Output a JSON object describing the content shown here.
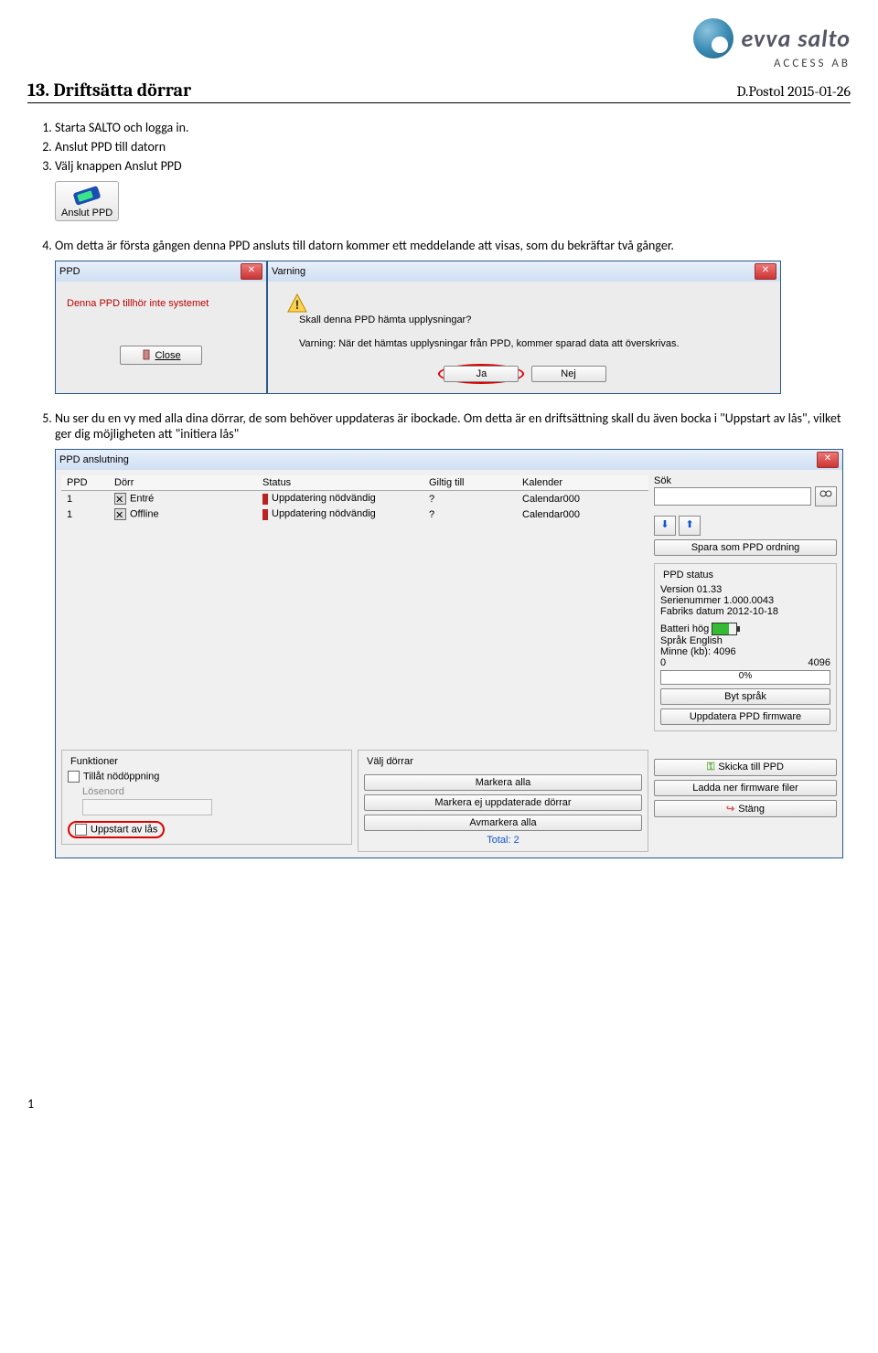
{
  "logo": {
    "line1": "evva salto",
    "line2": "ACCESS AB"
  },
  "title": "13. Driftsätta dörrar",
  "date": "D.Postol 2015-01-26",
  "steps123": [
    "Starta SALTO och logga in.",
    "Anslut PPD till datorn",
    "Välj knappen Anslut PPD"
  ],
  "anslut_btn_label": "Anslut PPD",
  "step4": "Om detta är första gången denna PPD ansluts till datorn kommer ett meddelande att visas, som du bekräftar två gånger.",
  "ppd_dialog": {
    "title": "PPD",
    "msg": "Denna PPD tillhör inte systemet",
    "close": "Close"
  },
  "warn_dialog": {
    "title": "Varning",
    "line1": "Skall denna PPD hämta upplysningar?",
    "line2": "Varning: När det hämtas upplysningar från PPD, kommer sparad data att överskrivas.",
    "yes": "Ja",
    "no": "Nej"
  },
  "step5": "Nu ser du en vy med alla dina dörrar, de som behöver uppdateras är ibockade. Om detta är en driftsättning skall du även bocka i \"Uppstart av lås\", vilket ger dig möjligheten att \"initiera lås\"",
  "main": {
    "title": "PPD anslutning",
    "cols": {
      "ppd": "PPD",
      "dorr": "Dörr",
      "status": "Status",
      "giltig": "Giltig till",
      "kalender": "Kalender"
    },
    "rows": [
      {
        "ppd": "1",
        "dorr": "Entré",
        "status": "Uppdatering nödvändig",
        "giltig": "?",
        "kal": "Calendar000"
      },
      {
        "ppd": "1",
        "dorr": "Offline",
        "status": "Uppdatering nödvändig",
        "giltig": "?",
        "kal": "Calendar000"
      }
    ],
    "sok": "Sök",
    "spara": "Spara som PPD ordning",
    "status_grp": "PPD status",
    "version_lbl": "Version",
    "version_val": "01.33",
    "serial_lbl": "Serienummer",
    "serial_val": "1.000.0043",
    "fabrik_lbl": "Fabriks datum",
    "fabrik_val": "2012-10-18",
    "batt_lbl": "Batteri",
    "batt_val": "hög",
    "sprak_lbl": "Språk",
    "sprak_val": "English",
    "minne_lbl": "Minne (kb):",
    "minne_val": "4096",
    "mem_lo": "0",
    "mem_hi": "4096",
    "mem_pct": "0%",
    "byt": "Byt språk",
    "updfw": "Uppdatera PPD firmware",
    "funktioner": "Funktioner",
    "tillat": "Tillåt nödöppning",
    "losen": "Lösenord",
    "uppstart": "Uppstart av lås",
    "valj": "Välj dörrar",
    "markera_alla": "Markera alla",
    "markera_ej": "Markera ej uppdaterade dörrar",
    "avmarkera": "Avmarkera alla",
    "total_lbl": "Total:",
    "total_val": "2",
    "skicka": "Skicka till PPD",
    "ladda": "Ladda ner firmware filer",
    "stang": "Stäng"
  },
  "pagenum": "1"
}
